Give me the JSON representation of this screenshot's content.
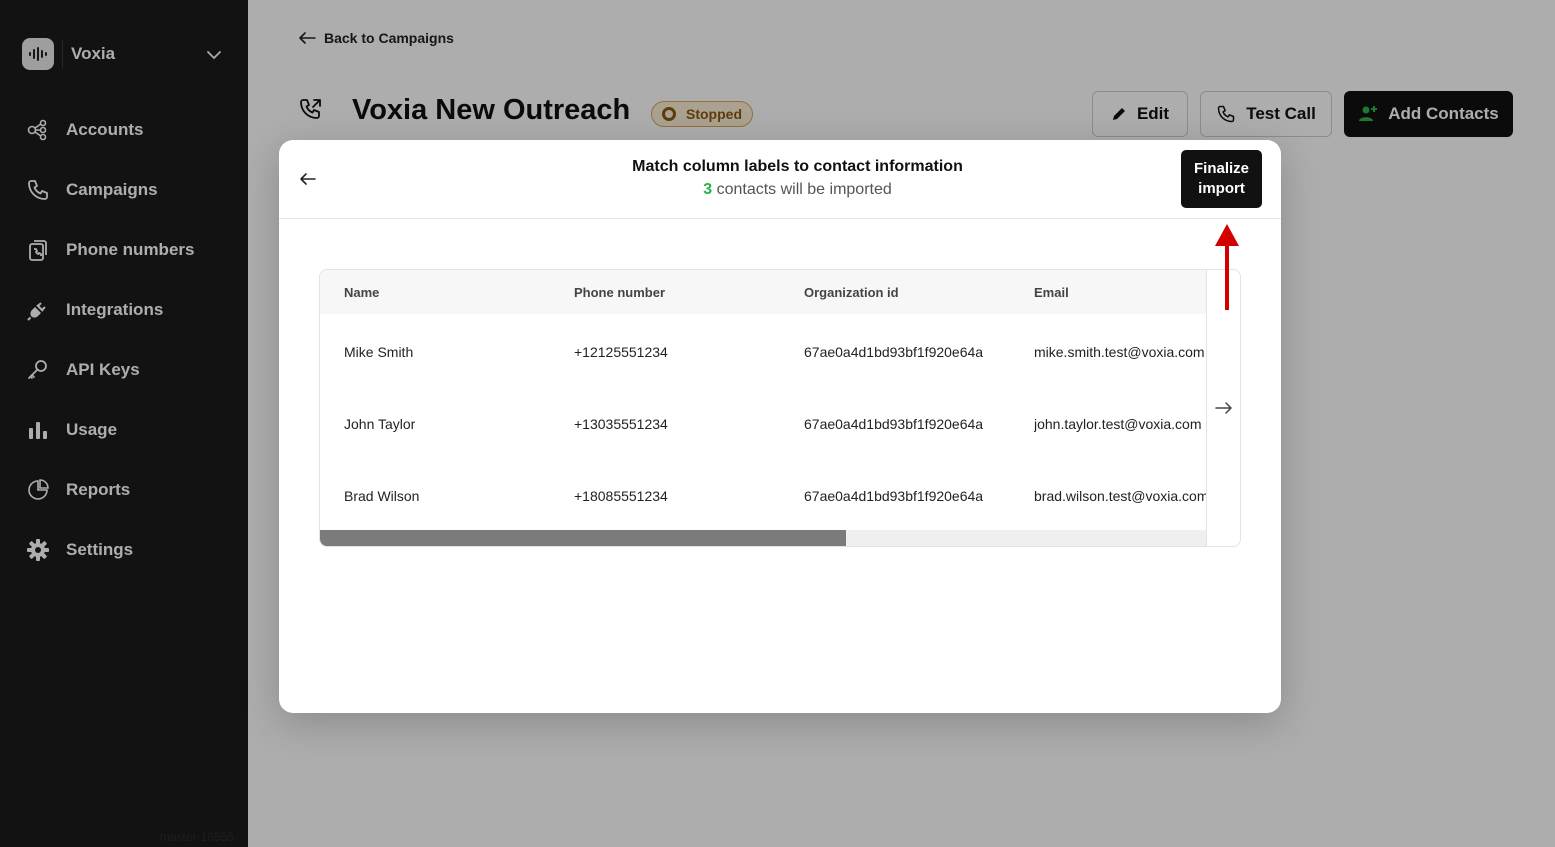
{
  "sidebar": {
    "brand": "Voxia",
    "items": [
      {
        "label": "Accounts",
        "icon": "accounts-icon"
      },
      {
        "label": "Campaigns",
        "icon": "phone-icon"
      },
      {
        "label": "Phone numbers",
        "icon": "phone-numbers-icon"
      },
      {
        "label": "Integrations",
        "icon": "plug-icon"
      },
      {
        "label": "API Keys",
        "icon": "key-icon"
      },
      {
        "label": "Usage",
        "icon": "bar-chart-icon"
      },
      {
        "label": "Reports",
        "icon": "pie-chart-icon"
      },
      {
        "label": "Settings",
        "icon": "gear-icon"
      }
    ],
    "version": "master-16555"
  },
  "page": {
    "back_label": "Back to Campaigns",
    "title": "Voxia New Outreach",
    "status": "Stopped",
    "edit_label": "Edit",
    "test_call_label": "Test Call",
    "add_contacts_label": "Add Contacts"
  },
  "modal": {
    "title": "Match column labels to contact information",
    "count": "3",
    "subtitle_rest": " contacts will be imported",
    "finalize_line1": "Finalize",
    "finalize_line2": "import",
    "columns": [
      "Name",
      "Phone number",
      "Organization id",
      "Email"
    ],
    "rows": [
      [
        "Mike Smith",
        "+12125551234",
        "67ae0a4d1bd93bf1f920e64a",
        "mike.smith.test@voxia.com"
      ],
      [
        "John Taylor",
        "+13035551234",
        "67ae0a4d1bd93bf1f920e64a",
        "john.taylor.test@voxia.com"
      ],
      [
        "Brad Wilson",
        "+18085551234",
        "67ae0a4d1bd93bf1f920e64a",
        "brad.wilson.test@voxia.com"
      ]
    ]
  },
  "colors": {
    "sidebar_bg": "#1b1b1b",
    "accent_green": "#2bb14a",
    "status_brown": "#8a5a12",
    "annotation_red": "#d40000"
  }
}
